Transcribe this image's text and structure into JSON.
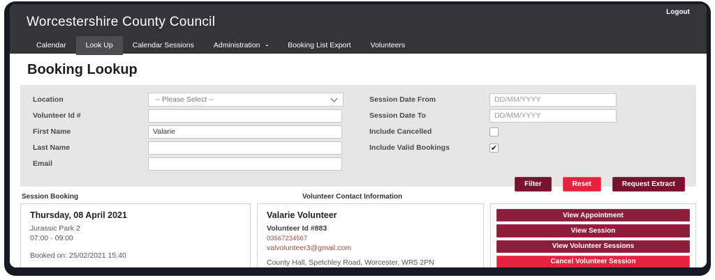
{
  "header": {
    "title": "Worcestershire County Council",
    "logout_label": "Logout",
    "nav": [
      {
        "label": "Calendar",
        "active": false
      },
      {
        "label": "Look Up",
        "active": true
      },
      {
        "label": "Calendar Sessions",
        "active": false
      },
      {
        "label": "Administration",
        "active": false,
        "indicator": "-"
      },
      {
        "label": "Booking List Export",
        "active": false
      },
      {
        "label": "Volunteers",
        "active": false
      }
    ]
  },
  "page": {
    "title": "Booking Lookup"
  },
  "filter_form": {
    "location": {
      "label": "Location",
      "selected": "-- Please Select --"
    },
    "volunteer_id": {
      "label": "Volunteer Id #",
      "value": ""
    },
    "first_name": {
      "label": "First Name",
      "value": "Valarie"
    },
    "last_name": {
      "label": "Last Name",
      "value": ""
    },
    "email": {
      "label": "Email",
      "value": ""
    },
    "session_date_from": {
      "label": "Session Date From",
      "value": "",
      "placeholder": "DD/MM/YYYY"
    },
    "session_date_to": {
      "label": "Session Date To",
      "value": "",
      "placeholder": "DD/MM/YYYY"
    },
    "include_cancelled": {
      "label": "Include Cancelled",
      "checked": false
    },
    "include_valid_bookings": {
      "label": "Include Valid Bookings",
      "checked": true
    },
    "buttons": {
      "filter": "Filter",
      "reset": "Reset",
      "request_extract": "Request Extract"
    }
  },
  "results": {
    "session_header": "Session Booking",
    "volunteer_header": "Volunteer Contact Information",
    "session": {
      "date": "Thursday, 08 April 2021",
      "location": "Jurassic Park 2",
      "time": "07:00 - 09:00",
      "booked_on": "Booked on: 25/02/2021 15:40"
    },
    "volunteer": {
      "name": "Valarie Volunteer",
      "id": "Volunteer Id #883",
      "phone": "03567234567",
      "email": "valvolunteer3@gmail.com",
      "address": "County Hall, Spetchley Road, Worcester, WR5 2PN"
    },
    "actions": [
      {
        "label": "View Appointment",
        "style": "dark"
      },
      {
        "label": "View Session",
        "style": "dark"
      },
      {
        "label": "View Volunteer Sessions",
        "style": "dark"
      },
      {
        "label": "Cancel Volunteer Session",
        "style": "bright"
      }
    ]
  },
  "colors": {
    "frame": "#151a25",
    "header_bg": "#333538",
    "active_tab_bg": "#4b4d50",
    "panel_bg": "#e6e6e6",
    "maroon": "#78122f",
    "maroon_light": "#8e1d3c",
    "crimson": "#e6233f",
    "link_red": "#9c4b43"
  },
  "glyphs": {
    "check": "✔"
  }
}
